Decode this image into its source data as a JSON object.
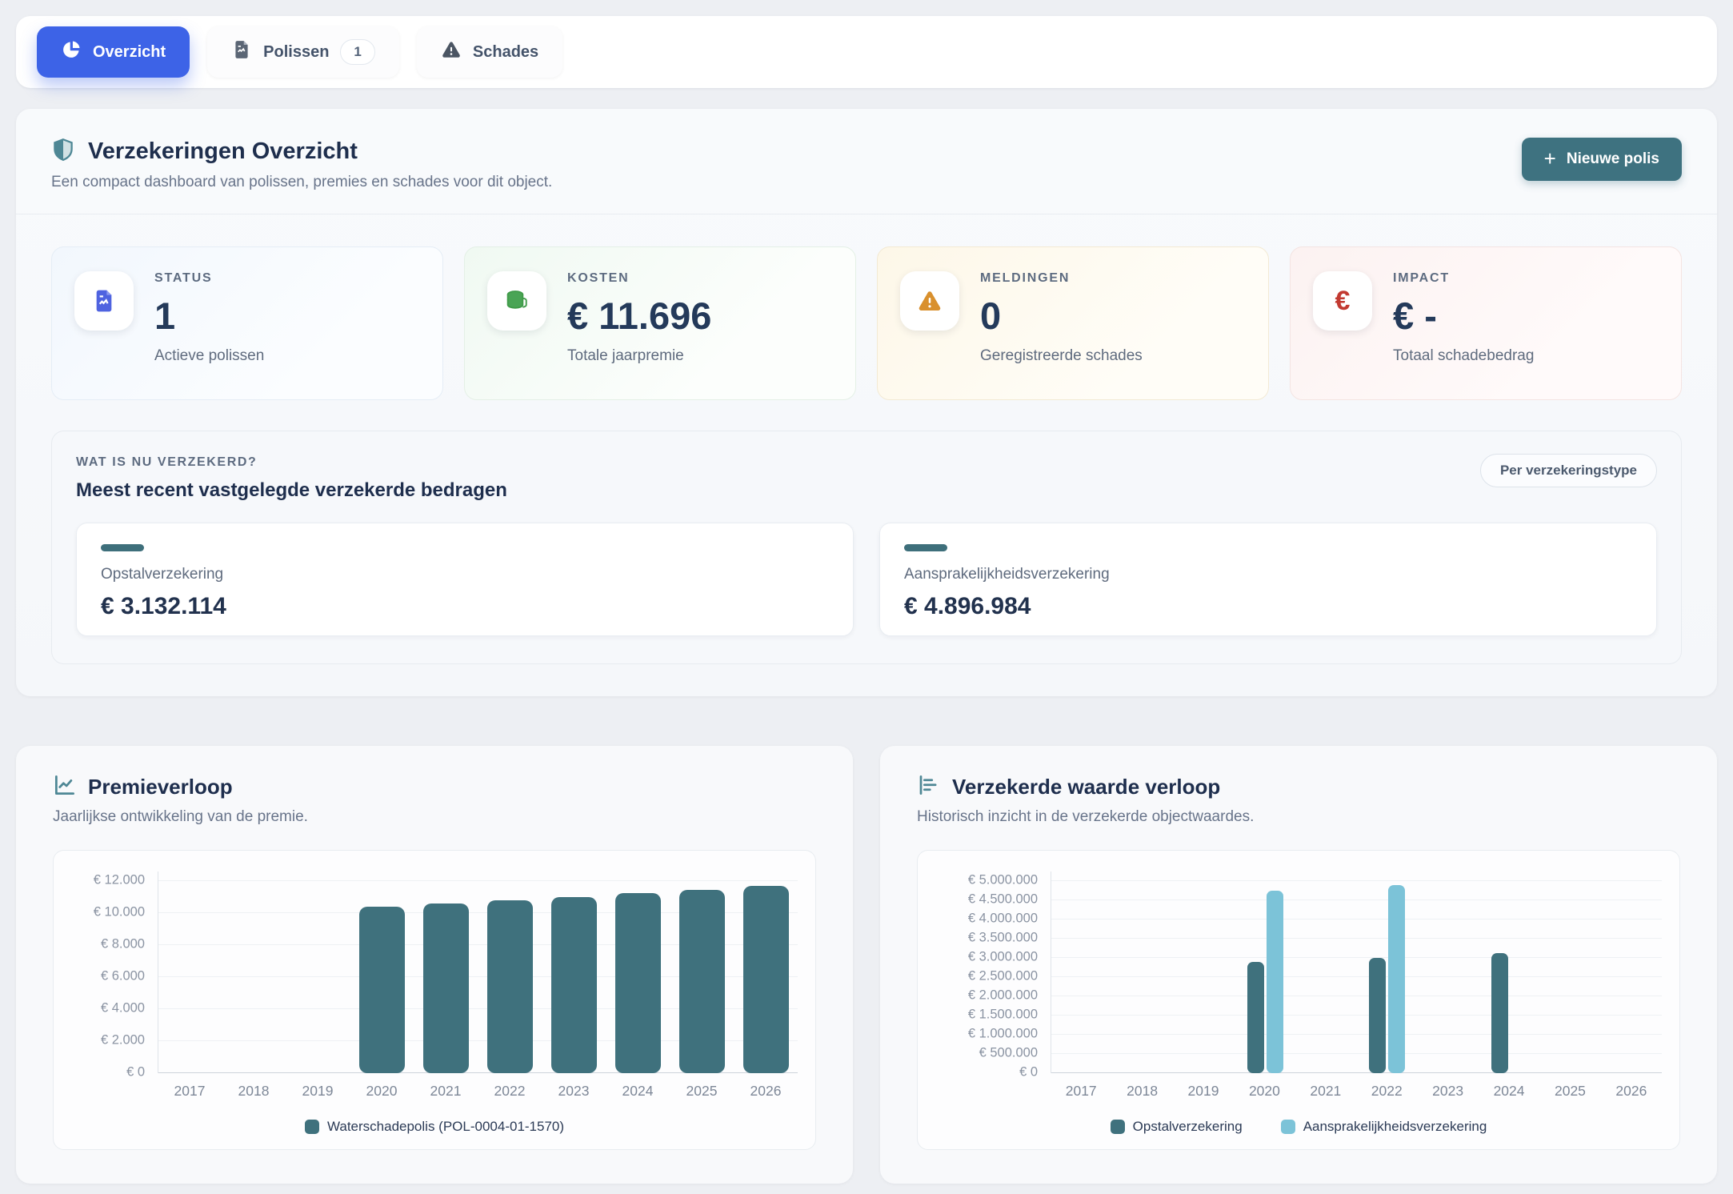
{
  "tabs": [
    {
      "label": "Overzicht",
      "icon": "pie-chart-icon",
      "active": true
    },
    {
      "label": "Polissen",
      "icon": "policy-file-icon",
      "badge": "1",
      "active": false
    },
    {
      "label": "Schades",
      "icon": "warning-triangle-icon",
      "active": false
    }
  ],
  "overview": {
    "title": "Verzekeringen Overzicht",
    "subtitle": "Een compact dashboard van polissen, premies en schades voor dit object.",
    "new_policy_button": "Nieuwe polis"
  },
  "icons": {
    "plus": "+",
    "euro": "€"
  },
  "stats": [
    {
      "label": "STATUS",
      "value": "1",
      "description": "Actieve polissen",
      "icon": "document-icon",
      "accent": "#4f63e0"
    },
    {
      "label": "KOSTEN",
      "value": "€ 11.696",
      "description": "Totale jaarpremie",
      "icon": "coins-icon",
      "accent": "#3f9a48"
    },
    {
      "label": "MELDINGEN",
      "value": "0",
      "description": "Geregistreerde schades",
      "icon": "warning-triangle-icon",
      "accent": "#d9902d"
    },
    {
      "label": "IMPACT",
      "value": "€ -",
      "description": "Totaal schadebedrag",
      "icon": "euro-icon",
      "accent": "#c23a31"
    }
  ],
  "insured": {
    "eyebrow": "WAT IS NU VERZEKERD?",
    "title": "Meest recent vastgelegde verzekerde bedragen",
    "badge": "Per verzekeringstype",
    "items": [
      {
        "name": "Opstalverzekering",
        "amount": "€ 3.132.114",
        "accent": "#3e6f7b"
      },
      {
        "name": "Aansprakelijkheidsverzekering",
        "amount": "€ 4.896.984",
        "accent": "#3e6f7b"
      }
    ]
  },
  "chart_data": [
    {
      "type": "bar",
      "title": "Premieverloop",
      "subtitle": "Jaarlijkse ontwikkeling van de premie.",
      "categories": [
        "2017",
        "2018",
        "2019",
        "2020",
        "2021",
        "2022",
        "2023",
        "2024",
        "2025",
        "2026"
      ],
      "series": [
        {
          "name": "Waterschadepolis (POL-0004-01-1570)",
          "color": "#3f717d",
          "values": [
            null,
            null,
            null,
            10385,
            10593,
            10805,
            11021,
            11242,
            11467,
            11696
          ]
        }
      ],
      "ylim": [
        0,
        12000
      ],
      "ystep": 2000,
      "ylabel_prefix": "€ ",
      "grid": true,
      "legend_position": "bottom"
    },
    {
      "type": "bar",
      "title": "Verzekerde waarde verloop",
      "subtitle": "Historisch inzicht in de verzekerde objectwaardes.",
      "categories": [
        "2017",
        "2018",
        "2019",
        "2020",
        "2021",
        "2022",
        "2023",
        "2024",
        "2025",
        "2026"
      ],
      "series": [
        {
          "name": "Opstalverzekering",
          "color": "#3f717d",
          "values": [
            null,
            null,
            null,
            2900000,
            null,
            3010000,
            null,
            3132114,
            null,
            null
          ]
        },
        {
          "name": "Aansprakelijkheidsverzekering",
          "color": "#7cc3d8",
          "values": [
            null,
            null,
            null,
            4740000,
            null,
            4896984,
            null,
            null,
            null,
            null
          ]
        }
      ],
      "ylim": [
        0,
        5000000
      ],
      "ystep": 500000,
      "ylabel_prefix": "€ ",
      "grid": true,
      "legend_position": "bottom"
    }
  ]
}
